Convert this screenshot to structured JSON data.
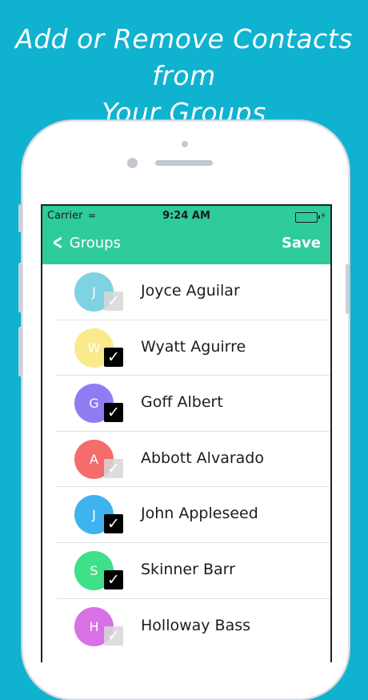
{
  "headline": {
    "line1": "Add or Remove Contacts from",
    "line2": "Your Groups"
  },
  "status_bar": {
    "carrier": "Carrier",
    "time": "9:24 AM"
  },
  "nav": {
    "back_label": "Groups",
    "save_label": "Save"
  },
  "colors": {
    "background": "#0fb3cf",
    "nav_bar": "#2ecb9b"
  },
  "contacts": [
    {
      "initial": "J",
      "name": "Joyce Aguilar",
      "color": "#7ed3e3",
      "checked": false
    },
    {
      "initial": "W",
      "name": "Wyatt Aguirre",
      "color": "#fbea8c",
      "checked": true
    },
    {
      "initial": "G",
      "name": "Goff Albert",
      "color": "#8f7bf2",
      "checked": true
    },
    {
      "initial": "A",
      "name": "Abbott Alvarado",
      "color": "#f36d6d",
      "checked": false
    },
    {
      "initial": "J",
      "name": "John Appleseed",
      "color": "#3fb3ee",
      "checked": true
    },
    {
      "initial": "S",
      "name": "Skinner Barr",
      "color": "#3ee08a",
      "checked": true
    },
    {
      "initial": "H",
      "name": "Holloway Bass",
      "color": "#d870e6",
      "checked": false
    }
  ]
}
